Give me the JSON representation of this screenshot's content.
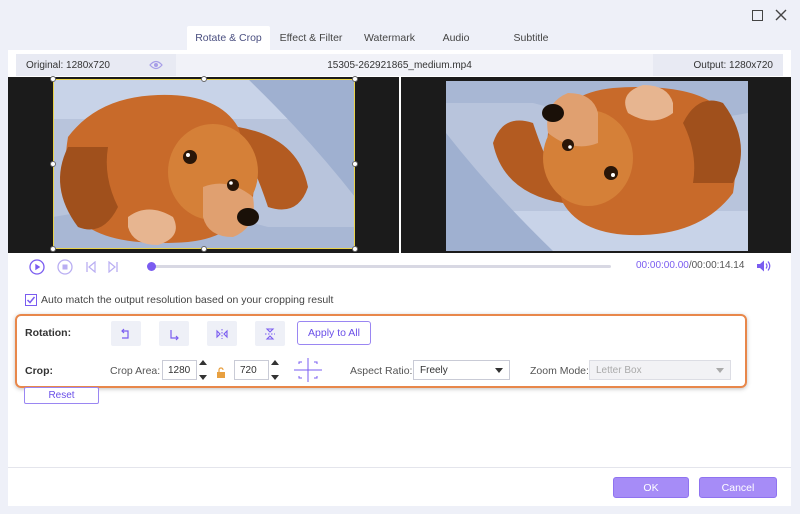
{
  "tabs": [
    {
      "label": "Rotate & Crop",
      "active": true
    },
    {
      "label": "Effect & Filter",
      "active": false
    },
    {
      "label": "Watermark",
      "active": false
    },
    {
      "label": "Audio",
      "active": false
    },
    {
      "label": "Subtitle",
      "active": false
    }
  ],
  "info": {
    "original": "Original: 1280x720",
    "filename": "15305-262921865_medium.mp4",
    "output": "Output: 1280x720"
  },
  "player": {
    "current_time": "00:00:00.00",
    "total_time": "/00:00:14.14",
    "progress": 0
  },
  "auto_match": {
    "label": "Auto match the output resolution based on your cropping result",
    "checked": true
  },
  "rotation": {
    "label": "Rotation:",
    "buttons": [
      "rotate-left-icon",
      "rotate-right-icon",
      "flip-horizontal-icon",
      "flip-vertical-icon"
    ],
    "apply_all": "Apply to All"
  },
  "crop": {
    "label": "Crop:",
    "area_label": "Crop Area:",
    "width": "1280",
    "height": "720",
    "aspect_label": "Aspect Ratio:",
    "aspect_value": "Freely",
    "zoom_label": "Zoom Mode:",
    "zoom_value": "Letter Box"
  },
  "buttons": {
    "reset": "Reset",
    "ok": "OK",
    "cancel": "Cancel"
  },
  "colors": {
    "accent": "#7a5cf0",
    "highlight_border": "#e8874a",
    "crop_frame": "#e8d24a"
  }
}
